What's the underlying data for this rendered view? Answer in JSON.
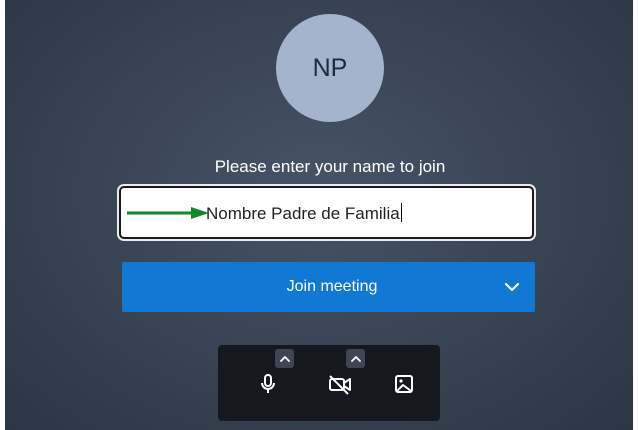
{
  "avatar": {
    "initials": "NP",
    "color": "#a4b4cc"
  },
  "prompt": "Please enter your name to join",
  "name_input": {
    "value": "Nombre Padre de Familia",
    "annotation": "green-arrow-icon"
  },
  "join_button": {
    "label": "Join meeting",
    "color": "#1178d4",
    "options_icon": "chevron-down-icon"
  },
  "toolbar": {
    "items": [
      {
        "icon": "microphone-icon",
        "has_options": true
      },
      {
        "icon": "camera-off-icon",
        "has_options": true
      },
      {
        "icon": "background-image-icon",
        "has_options": false
      }
    ]
  }
}
